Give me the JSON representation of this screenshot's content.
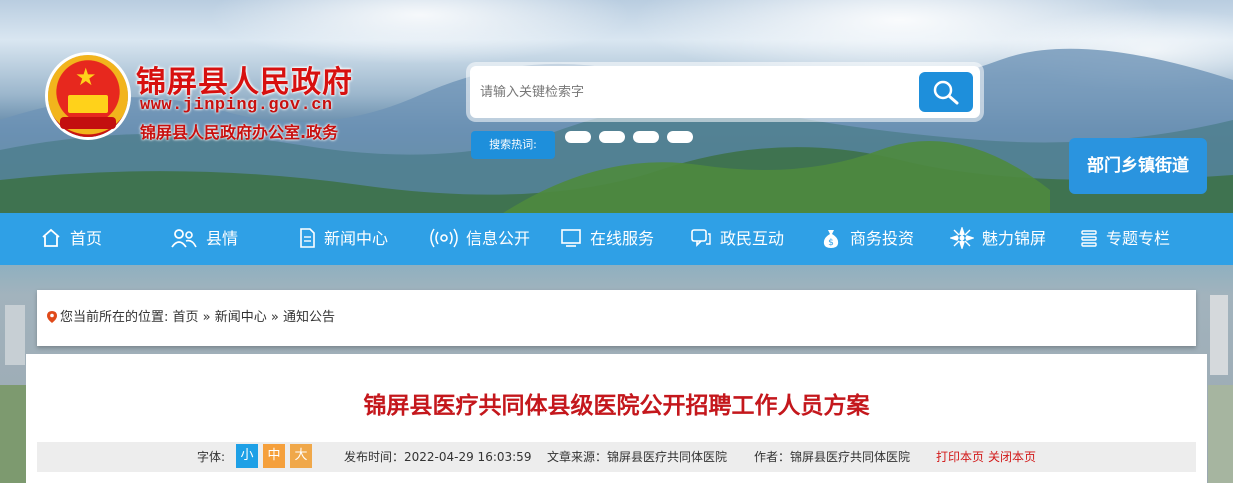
{
  "header": {
    "site_title": "锦屏县人民政府",
    "site_url": "www.jinping.gov.cn",
    "site_subtitle": "锦屏县人民政府办公室.政务",
    "search_placeholder": "请输入关键检索字",
    "hot_label": "搜索热词:",
    "dept_button": "部门乡镇街道"
  },
  "nav": {
    "items": [
      {
        "label": "首页",
        "icon": "home-icon"
      },
      {
        "label": "县情",
        "icon": "people-icon"
      },
      {
        "label": "新闻中心",
        "icon": "document-icon"
      },
      {
        "label": "信息公开",
        "icon": "broadcast-icon"
      },
      {
        "label": "在线服务",
        "icon": "monitor-icon"
      },
      {
        "label": "政民互动",
        "icon": "chat-icon"
      },
      {
        "label": "商务投资",
        "icon": "money-bag-icon"
      },
      {
        "label": "魅力锦屏",
        "icon": "flower-icon"
      },
      {
        "label": "专题专栏",
        "icon": "stack-icon"
      }
    ]
  },
  "breadcrumb": {
    "prefix": "您当前所在的位置:",
    "path": "首页 » 新闻中心 » 通知公告"
  },
  "article": {
    "title": "锦屏县医疗共同体县级医院公开招聘工作人员方案",
    "font_label": "字体:",
    "font_sizes": [
      "小",
      "中",
      "大"
    ],
    "publish_time": "发布时间：2022-04-29 16:03:59",
    "source": "文章来源：锦屏县医疗共同体医院",
    "author": "作者：锦屏县医疗共同体医院",
    "print_label": "打印本页",
    "close_label": "关闭本页"
  },
  "colors": {
    "nav_bg": "#2fa0e6",
    "accent_blue": "#1e8fdb",
    "title_red": "#c4171c",
    "font_small_bg": "#1ea0e6",
    "font_mid_bg": "#f5a03c",
    "font_large_bg": "#f0a84a"
  }
}
